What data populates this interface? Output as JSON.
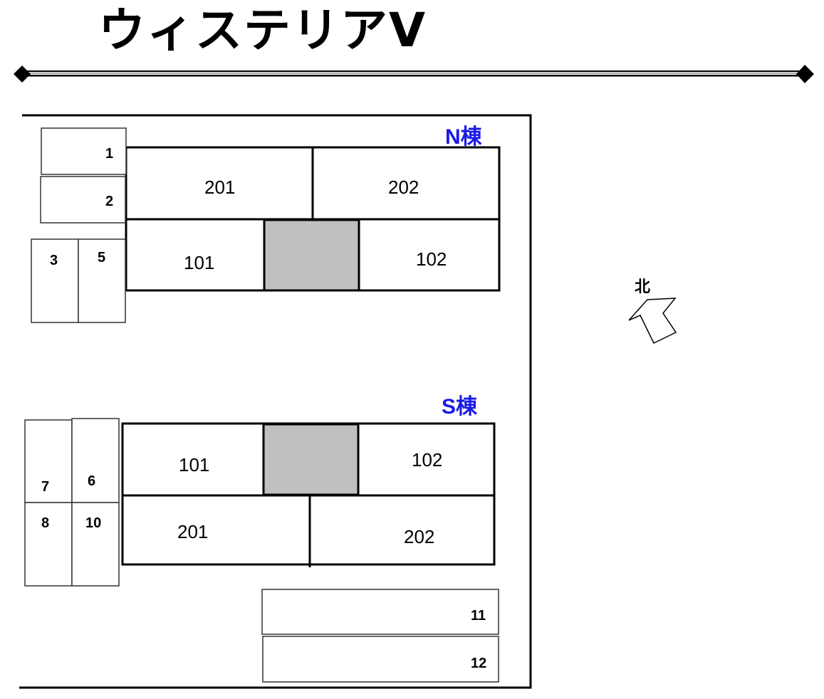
{
  "title": "ウィステリアⅤ",
  "colors": {
    "building_label": "#1a1ae6",
    "common_area": "#c0c0c0",
    "line": "#000000"
  },
  "north_label": "北",
  "buildings": [
    {
      "name": "N棟",
      "rooms": [
        "201",
        "202",
        "101",
        "102"
      ]
    },
    {
      "name": "S棟",
      "rooms": [
        "101",
        "102",
        "201",
        "202"
      ]
    }
  ],
  "parking": [
    "1",
    "2",
    "3",
    "5",
    "7",
    "6",
    "8",
    "10",
    "11",
    "12"
  ]
}
